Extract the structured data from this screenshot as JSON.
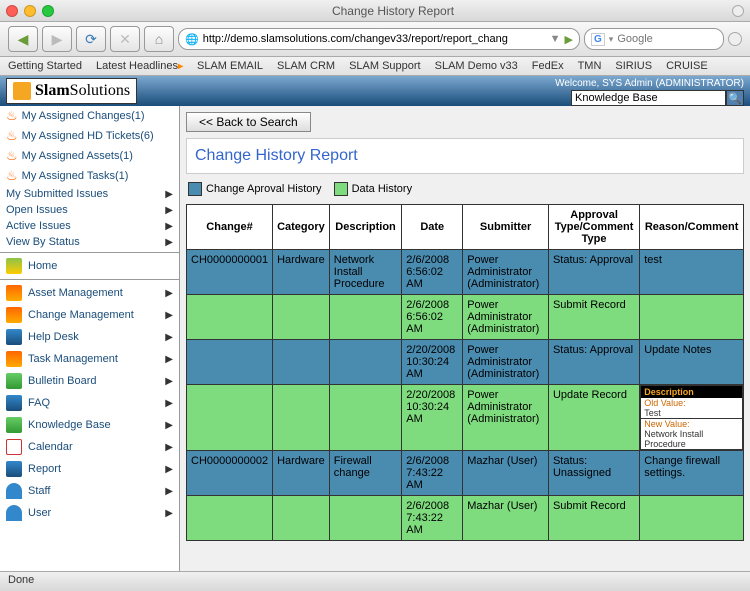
{
  "window": {
    "title": "Change History Report"
  },
  "browser": {
    "url": "http://demo.slamsolutions.com/changev33/report/report_chang",
    "search_placeholder": "Google",
    "bookmarks": [
      "Getting Started",
      "Latest Headlines",
      "SLAM EMAIL",
      "SLAM CRM",
      "SLAM Support",
      "SLAM Demo v33",
      "FedEx",
      "TMN",
      "SIRIUS",
      "CRUISE"
    ]
  },
  "header": {
    "welcome": "Welcome, SYS Admin (ADMINISTRATOR)",
    "kb_placeholder": "Knowledge Base",
    "logo_bold": "Slam",
    "logo_rest": "Solutions"
  },
  "sidebar": {
    "assigned": [
      "My Assigned Changes(1)",
      "My Assigned HD Tickets(6)",
      "My Assigned Assets(1)",
      "My Assigned Tasks(1)"
    ],
    "filters": [
      "My Submitted Issues",
      "Open Issues",
      "Active Issues",
      "View By Status"
    ],
    "nav": [
      "Home",
      "Asset Management",
      "Change Management",
      "Help Desk",
      "Task Management",
      "Bulletin Board",
      "FAQ",
      "Knowledge Base",
      "Calendar",
      "Report",
      "Staff",
      "User"
    ]
  },
  "main": {
    "back_label": "<< Back to Search",
    "title": "Change History Report",
    "legend": {
      "approval": "Change Aproval History",
      "data": "Data History"
    },
    "columns": [
      "Change#",
      "Category",
      "Description",
      "Date",
      "Submitter",
      "Approval Type/Comment Type",
      "Reason/Comment"
    ],
    "rows": [
      {
        "class": "row-blue",
        "cells": [
          "CH0000000001",
          "Hardware",
          "Network Install Procedure",
          "2/6/2008 6:56:02 AM",
          "Power Administrator (Administrator)",
          "Status: Approval",
          "test"
        ]
      },
      {
        "class": "row-green",
        "cells": [
          "",
          "",
          "",
          "2/6/2008 6:56:02 AM",
          "Power Administrator (Administrator)",
          "Submit Record",
          ""
        ]
      },
      {
        "class": "row-blue",
        "cells": [
          "",
          "",
          "",
          "2/20/2008 10:30:24 AM",
          "Power Administrator (Administrator)",
          "Status: Approval",
          "Update Notes"
        ]
      },
      {
        "class": "row-green",
        "cells": [
          "",
          "",
          "",
          "2/20/2008 10:30:24 AM",
          "Power Administrator (Administrator)",
          "Update Record",
          "__TOOLTIP__"
        ]
      },
      {
        "class": "row-blue",
        "cells": [
          "CH0000000002",
          "Hardware",
          "Firewall change",
          "2/6/2008 7:43:22 AM",
          "Mazhar (User)",
          "Status: Unassigned",
          "Change firewall settings."
        ]
      },
      {
        "class": "row-green",
        "cells": [
          "",
          "",
          "",
          "2/6/2008 7:43:22 AM",
          "Mazhar (User)",
          "Submit Record",
          ""
        ]
      }
    ],
    "tooltip": {
      "header": "Description",
      "old_label": "Old Value:",
      "old_value": "Test",
      "new_label": "New Value:",
      "new_value": "Network Install Procedure"
    }
  },
  "status": "Done"
}
